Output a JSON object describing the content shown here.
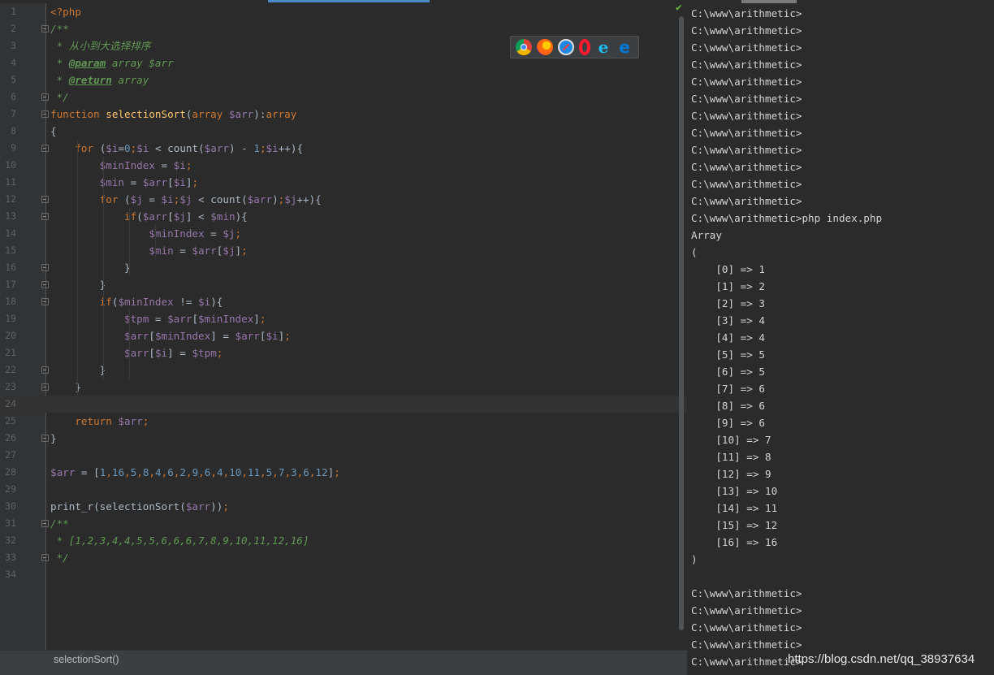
{
  "editor": {
    "lines": [
      {
        "n": "1",
        "tokens": [
          [
            "kw",
            "<?php"
          ]
        ]
      },
      {
        "n": "2",
        "tokens": [
          [
            "cmt",
            "/**"
          ]
        ]
      },
      {
        "n": "3",
        "tokens": [
          [
            "cmt",
            " * 从小到大选择排序"
          ]
        ]
      },
      {
        "n": "4",
        "tokens": [
          [
            "cmt",
            " * "
          ],
          [
            "tag",
            "@param"
          ],
          [
            "cmt",
            " array $arr"
          ]
        ]
      },
      {
        "n": "5",
        "tokens": [
          [
            "cmt",
            " * "
          ],
          [
            "tag",
            "@return"
          ],
          [
            "cmt",
            " array"
          ]
        ]
      },
      {
        "n": "6",
        "tokens": [
          [
            "cmt",
            " */"
          ]
        ]
      },
      {
        "n": "7",
        "tokens": [
          [
            "kw",
            "function "
          ],
          [
            "fn",
            "selectionSort"
          ],
          [
            "plain",
            "("
          ],
          [
            "kw",
            "array "
          ],
          [
            "var",
            "$arr"
          ],
          [
            "plain",
            "):"
          ],
          [
            "kw",
            "array"
          ]
        ]
      },
      {
        "n": "8",
        "tokens": [
          [
            "plain",
            "{"
          ]
        ]
      },
      {
        "n": "9",
        "tokens": [
          [
            "plain",
            "    "
          ],
          [
            "kw",
            "for "
          ],
          [
            "plain",
            "("
          ],
          [
            "var",
            "$i"
          ],
          [
            "plain",
            "="
          ],
          [
            "num",
            "0"
          ],
          [
            "kw",
            ";"
          ],
          [
            "var",
            "$i"
          ],
          [
            "plain",
            " < count("
          ],
          [
            "var",
            "$arr"
          ],
          [
            "plain",
            ") - "
          ],
          [
            "num",
            "1"
          ],
          [
            "kw",
            ";"
          ],
          [
            "var",
            "$i"
          ],
          [
            "plain",
            "++){"
          ]
        ]
      },
      {
        "n": "10",
        "tokens": [
          [
            "plain",
            "        "
          ],
          [
            "var",
            "$minIndex"
          ],
          [
            "plain",
            " = "
          ],
          [
            "var",
            "$i"
          ],
          [
            "kw",
            ";"
          ]
        ]
      },
      {
        "n": "11",
        "tokens": [
          [
            "plain",
            "        "
          ],
          [
            "var",
            "$min"
          ],
          [
            "plain",
            " = "
          ],
          [
            "var",
            "$arr"
          ],
          [
            "plain",
            "["
          ],
          [
            "var",
            "$i"
          ],
          [
            "plain",
            "]"
          ],
          [
            "kw",
            ";"
          ]
        ]
      },
      {
        "n": "12",
        "tokens": [
          [
            "plain",
            "        "
          ],
          [
            "kw",
            "for "
          ],
          [
            "plain",
            "("
          ],
          [
            "var",
            "$j"
          ],
          [
            "plain",
            " = "
          ],
          [
            "var",
            "$i"
          ],
          [
            "kw",
            ";"
          ],
          [
            "var",
            "$j"
          ],
          [
            "plain",
            " < count("
          ],
          [
            "var",
            "$arr"
          ],
          [
            "plain",
            ")"
          ],
          [
            "kw",
            ";"
          ],
          [
            "var",
            "$j"
          ],
          [
            "plain",
            "++){"
          ]
        ]
      },
      {
        "n": "13",
        "tokens": [
          [
            "plain",
            "            "
          ],
          [
            "kw",
            "if"
          ],
          [
            "plain",
            "("
          ],
          [
            "var",
            "$arr"
          ],
          [
            "plain",
            "["
          ],
          [
            "var",
            "$j"
          ],
          [
            "plain",
            "] < "
          ],
          [
            "var",
            "$min"
          ],
          [
            "plain",
            "){"
          ]
        ]
      },
      {
        "n": "14",
        "tokens": [
          [
            "plain",
            "                "
          ],
          [
            "var",
            "$minIndex"
          ],
          [
            "plain",
            " = "
          ],
          [
            "var",
            "$j"
          ],
          [
            "kw",
            ";"
          ]
        ]
      },
      {
        "n": "15",
        "tokens": [
          [
            "plain",
            "                "
          ],
          [
            "var",
            "$min"
          ],
          [
            "plain",
            " = "
          ],
          [
            "var",
            "$arr"
          ],
          [
            "plain",
            "["
          ],
          [
            "var",
            "$j"
          ],
          [
            "plain",
            "]"
          ],
          [
            "kw",
            ";"
          ]
        ]
      },
      {
        "n": "16",
        "tokens": [
          [
            "plain",
            "            }"
          ]
        ]
      },
      {
        "n": "17",
        "tokens": [
          [
            "plain",
            "        }"
          ]
        ]
      },
      {
        "n": "18",
        "tokens": [
          [
            "plain",
            "        "
          ],
          [
            "kw",
            "if"
          ],
          [
            "plain",
            "("
          ],
          [
            "var",
            "$minIndex"
          ],
          [
            "plain",
            " != "
          ],
          [
            "var",
            "$i"
          ],
          [
            "plain",
            "){"
          ]
        ]
      },
      {
        "n": "19",
        "tokens": [
          [
            "plain",
            "            "
          ],
          [
            "var",
            "$tpm"
          ],
          [
            "plain",
            " = "
          ],
          [
            "var",
            "$arr"
          ],
          [
            "plain",
            "["
          ],
          [
            "var",
            "$minIndex"
          ],
          [
            "plain",
            "]"
          ],
          [
            "kw",
            ";"
          ]
        ]
      },
      {
        "n": "20",
        "tokens": [
          [
            "plain",
            "            "
          ],
          [
            "var",
            "$arr"
          ],
          [
            "plain",
            "["
          ],
          [
            "var",
            "$minIndex"
          ],
          [
            "plain",
            "] = "
          ],
          [
            "var",
            "$arr"
          ],
          [
            "plain",
            "["
          ],
          [
            "var",
            "$i"
          ],
          [
            "plain",
            "]"
          ],
          [
            "kw",
            ";"
          ]
        ]
      },
      {
        "n": "21",
        "tokens": [
          [
            "plain",
            "            "
          ],
          [
            "var",
            "$arr"
          ],
          [
            "plain",
            "["
          ],
          [
            "var",
            "$i"
          ],
          [
            "plain",
            "] = "
          ],
          [
            "var",
            "$tpm"
          ],
          [
            "kw",
            ";"
          ]
        ]
      },
      {
        "n": "22",
        "tokens": [
          [
            "plain",
            "        }"
          ]
        ]
      },
      {
        "n": "23",
        "tokens": [
          [
            "plain",
            "    }"
          ]
        ]
      },
      {
        "n": "24",
        "tokens": []
      },
      {
        "n": "25",
        "tokens": [
          [
            "plain",
            "    "
          ],
          [
            "kw",
            "return "
          ],
          [
            "var",
            "$arr"
          ],
          [
            "kw",
            ";"
          ]
        ]
      },
      {
        "n": "26",
        "tokens": [
          [
            "plain",
            "}"
          ]
        ]
      },
      {
        "n": "27",
        "tokens": []
      },
      {
        "n": "28",
        "tokens": [
          [
            "var",
            "$arr"
          ],
          [
            "plain",
            " = ["
          ],
          [
            "num",
            "1"
          ],
          [
            "kw",
            ","
          ],
          [
            "num",
            "16"
          ],
          [
            "kw",
            ","
          ],
          [
            "num",
            "5"
          ],
          [
            "kw",
            ","
          ],
          [
            "num",
            "8"
          ],
          [
            "kw",
            ","
          ],
          [
            "num",
            "4"
          ],
          [
            "kw",
            ","
          ],
          [
            "num",
            "6"
          ],
          [
            "kw",
            ","
          ],
          [
            "num",
            "2"
          ],
          [
            "kw",
            ","
          ],
          [
            "num",
            "9"
          ],
          [
            "kw",
            ","
          ],
          [
            "num",
            "6"
          ],
          [
            "kw",
            ","
          ],
          [
            "num",
            "4"
          ],
          [
            "kw",
            ","
          ],
          [
            "num",
            "10"
          ],
          [
            "kw",
            ","
          ],
          [
            "num",
            "11"
          ],
          [
            "kw",
            ","
          ],
          [
            "num",
            "5"
          ],
          [
            "kw",
            ","
          ],
          [
            "num",
            "7"
          ],
          [
            "kw",
            ","
          ],
          [
            "num",
            "3"
          ],
          [
            "kw",
            ","
          ],
          [
            "num",
            "6"
          ],
          [
            "kw",
            ","
          ],
          [
            "num",
            "12"
          ],
          [
            "plain",
            "]"
          ],
          [
            "kw",
            ";"
          ]
        ]
      },
      {
        "n": "29",
        "tokens": []
      },
      {
        "n": "30",
        "tokens": [
          [
            "plain",
            "print_r(selectionSort("
          ],
          [
            "var",
            "$arr"
          ],
          [
            "plain",
            "))"
          ],
          [
            "kw",
            ";"
          ]
        ]
      },
      {
        "n": "31",
        "tokens": [
          [
            "cmt",
            "/**"
          ]
        ]
      },
      {
        "n": "32",
        "tokens": [
          [
            "cmt",
            " * [1,2,3,4,4,5,5,6,6,6,7,8,9,10,11,12,16]"
          ]
        ]
      },
      {
        "n": "33",
        "tokens": [
          [
            "cmt",
            " */"
          ]
        ]
      },
      {
        "n": "34",
        "tokens": []
      }
    ],
    "current_line": "24",
    "fold_markers": [
      "2",
      "6",
      "7",
      "9",
      "12",
      "13",
      "16",
      "17",
      "18",
      "22",
      "23",
      "26",
      "31",
      "33"
    ]
  },
  "status_bar": {
    "breadcrumb": "selectionSort()"
  },
  "browser_icons": [
    "chrome-icon",
    "firefox-icon",
    "safari-icon",
    "opera-icon",
    "ie-icon",
    "edge-icon"
  ],
  "terminal": {
    "lines": [
      "C:\\www\\arithmetic>",
      "C:\\www\\arithmetic>",
      "C:\\www\\arithmetic>",
      "C:\\www\\arithmetic>",
      "C:\\www\\arithmetic>",
      "C:\\www\\arithmetic>",
      "C:\\www\\arithmetic>",
      "C:\\www\\arithmetic>",
      "C:\\www\\arithmetic>",
      "C:\\www\\arithmetic>",
      "C:\\www\\arithmetic>",
      "C:\\www\\arithmetic>",
      "C:\\www\\arithmetic>php index.php",
      "Array",
      "(",
      "    [0] => 1",
      "    [1] => 2",
      "    [2] => 3",
      "    [3] => 4",
      "    [4] => 4",
      "    [5] => 5",
      "    [6] => 5",
      "    [7] => 6",
      "    [8] => 6",
      "    [9] => 6",
      "    [10] => 7",
      "    [11] => 8",
      "    [12] => 9",
      "    [13] => 10",
      "    [14] => 11",
      "    [15] => 12",
      "    [16] => 16",
      ")",
      "",
      "C:\\www\\arithmetic>",
      "C:\\www\\arithmetic>",
      "C:\\www\\arithmetic>",
      "C:\\www\\arithmetic>",
      "C:\\www\\arithmetic>"
    ]
  },
  "watermark": "https://blog.csdn.net/qq_38937634",
  "colors": {
    "background": "#2b2b2b",
    "keyword": "#cc7832",
    "function": "#ffc66d",
    "variable": "#9876aa",
    "number": "#6897bb",
    "comment": "#629755",
    "text": "#a9b7c6"
  }
}
